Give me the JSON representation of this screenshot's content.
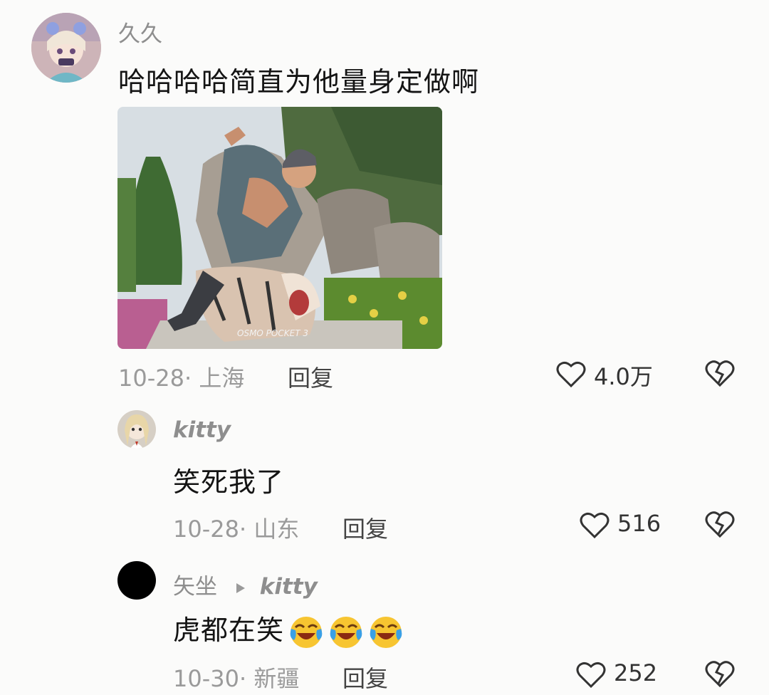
{
  "comments": [
    {
      "author": "久久",
      "text": "哈哈哈哈简直为他量身定做啊",
      "date": "10-28",
      "location": "上海",
      "reply_label": "回复",
      "likes": "4.0万",
      "image_caption": "OSMO POCKET 3"
    },
    {
      "author": "kitty",
      "text": "笑死我了",
      "date": "10-28",
      "location": "山东",
      "reply_label": "回复",
      "likes": "516"
    },
    {
      "author": "矢坐",
      "reply_to": "kitty",
      "text": "虎都在笑",
      "date": "10-30",
      "location": "新疆",
      "reply_label": "回复",
      "likes": "252",
      "emoji_count": 3
    }
  ],
  "icons": {
    "like": "heart-outline-icon",
    "dislike": "broken-heart-icon",
    "reply_arrow": "play-triangle-icon",
    "emoji": "laughing-crying-emoji"
  },
  "colors": {
    "background": "#fbfbfa",
    "name": "#8e8e8e",
    "meta": "#9a9a9a",
    "text": "#141414"
  }
}
